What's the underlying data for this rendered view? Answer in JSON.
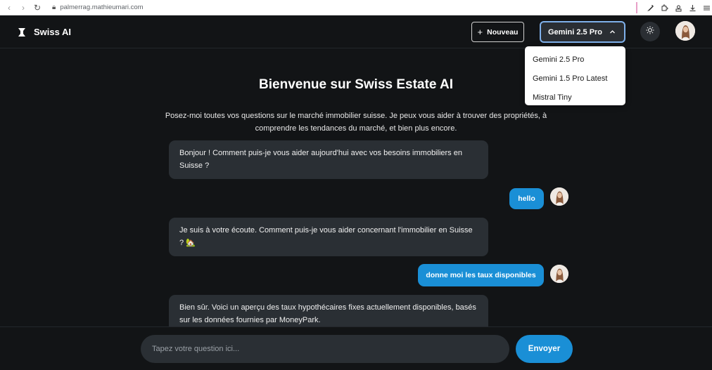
{
  "browser": {
    "url": "palmerrag.mathieumari.com"
  },
  "header": {
    "app_name": "Swiss AI",
    "new_button_label": "Nouveau",
    "selected_model": "Gemini 2.5 Pro"
  },
  "model_dropdown": {
    "options": [
      "Gemini 2.5 Pro",
      "Gemini 1.5 Pro Latest",
      "Mistral Tiny"
    ]
  },
  "welcome": {
    "title": "Bienvenue sur Swiss Estate AI",
    "subtitle": "Posez-moi toutes vos questions sur le marché immobilier suisse. Je peux vous aider à trouver des propriétés, à comprendre les tendances du marché, et bien plus encore."
  },
  "messages": [
    {
      "role": "assistant",
      "text": "Bonjour ! Comment puis-je vous aider aujourd'hui avec vos besoins immobiliers en Suisse ?"
    },
    {
      "role": "user",
      "text": "hello"
    },
    {
      "role": "assistant",
      "text": "Je suis à votre écoute. Comment puis-je vous aider concernant l'immobilier en Suisse ? 🏡"
    },
    {
      "role": "user",
      "text": "donne moi les taux disponibles"
    },
    {
      "role": "assistant",
      "text": "Bien sûr. Voici un aperçu des taux hypothécaires fixes actuellement disponibles, basés sur les données fournies par MoneyPark."
    }
  ],
  "composer": {
    "placeholder": "Tapez votre question ici...",
    "send_label": "Envoyer"
  },
  "colors": {
    "accent": "#1a8fd6",
    "background": "#121416",
    "bubble": "#2a2f34"
  }
}
